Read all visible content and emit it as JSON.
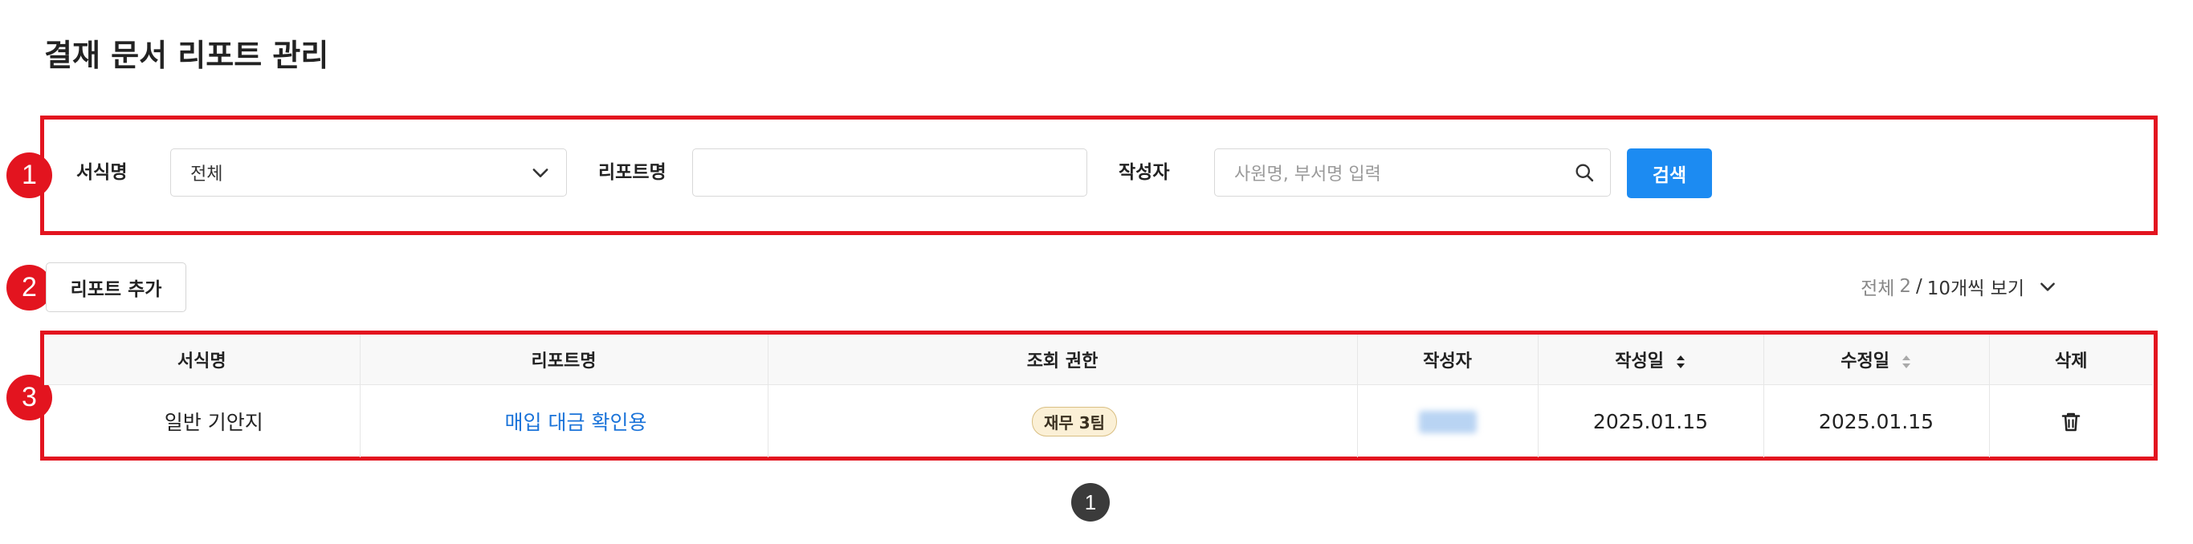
{
  "page": {
    "title": "결재 문서 리포트 관리"
  },
  "markers": [
    "1",
    "2",
    "3"
  ],
  "filters": {
    "form_label": "서식명",
    "form_value": "전체",
    "report_label": "리포트명",
    "report_value": "",
    "author_label": "작성자",
    "author_placeholder": "사원명, 부서명 입력",
    "search_button": "검색"
  },
  "actions": {
    "add_report": "리포트 추가"
  },
  "pager": {
    "total_label": "전체",
    "total_count": "2",
    "separator": "/",
    "page_size": "10개씩 보기",
    "current_page": "1"
  },
  "table": {
    "headers": {
      "form": "서식명",
      "report": "리포트명",
      "permission": "조회 권한",
      "author": "작성자",
      "created": "작성일",
      "modified": "수정일",
      "delete": "삭제"
    },
    "rows": [
      {
        "form": "일반 기안지",
        "report": "매입 대금 확인용",
        "permission": "재무 3팀",
        "author": "",
        "created": "2025.01.15",
        "modified": "2025.01.15"
      }
    ]
  },
  "colors": {
    "accent": "#1c8bf2",
    "annotation": "#e3141f",
    "link": "#1a73d9",
    "badge_bg": "#fbf0d6"
  },
  "icons": [
    "chevron-down-icon",
    "search-icon",
    "sort-icon",
    "trash-icon"
  ]
}
